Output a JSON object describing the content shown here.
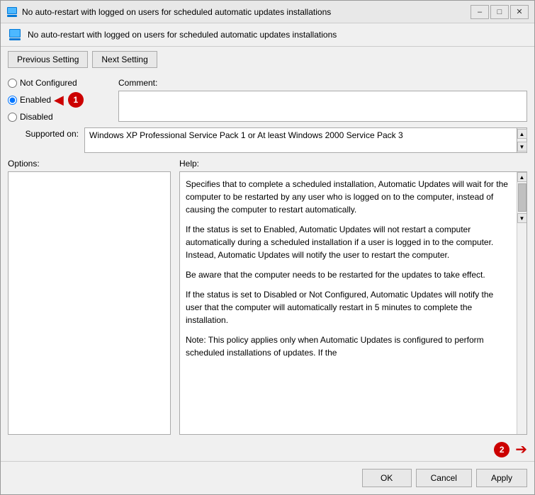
{
  "window": {
    "title": "No auto-restart with logged on users for scheduled automatic updates installations",
    "subtitle": "No auto-restart with logged on users for scheduled automatic updates installations"
  },
  "nav": {
    "previous_label": "Previous Setting",
    "next_label": "Next Setting"
  },
  "settings": {
    "not_configured_label": "Not Configured",
    "enabled_label": "Enabled",
    "disabled_label": "Disabled",
    "selected": "enabled"
  },
  "comment": {
    "label": "Comment:",
    "value": "",
    "placeholder": ""
  },
  "supported": {
    "label": "Supported on:",
    "value": "Windows XP Professional Service Pack 1 or At least Windows 2000 Service Pack 3"
  },
  "panels": {
    "options_label": "Options:",
    "help_label": "Help:"
  },
  "help_text": {
    "para1": "Specifies that to complete a scheduled installation, Automatic Updates will wait for the computer to be restarted by any user who is logged on to the computer, instead of causing the computer to restart automatically.",
    "para2": "If the status is set to Enabled, Automatic Updates will not restart a computer automatically during a scheduled installation if a user is logged in to the computer. Instead, Automatic Updates will notify the user to restart the computer.",
    "para3": "Be aware that the computer needs to be restarted for the updates to take effect.",
    "para4": "If the status is set to Disabled or Not Configured, Automatic Updates will notify the user that the computer will automatically restart in 5 minutes to complete the installation.",
    "para5": "Note: This policy applies only when Automatic Updates is configured to perform scheduled installations of updates. If the"
  },
  "buttons": {
    "ok_label": "OK",
    "cancel_label": "Cancel",
    "apply_label": "Apply"
  },
  "badges": {
    "badge1": "1",
    "badge2": "2"
  }
}
